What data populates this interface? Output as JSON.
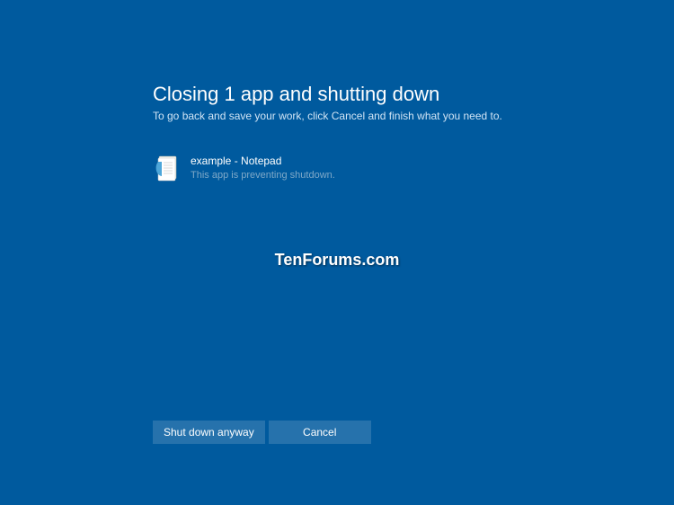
{
  "header": {
    "title": "Closing 1 app and shutting down",
    "subtitle": "To go back and save your work, click Cancel and finish what you need to."
  },
  "apps": [
    {
      "name": "example - Notepad",
      "status": "This app is preventing shutdown."
    }
  ],
  "watermark": "TenForums.com",
  "buttons": {
    "primary": "Shut down anyway",
    "cancel": "Cancel"
  }
}
